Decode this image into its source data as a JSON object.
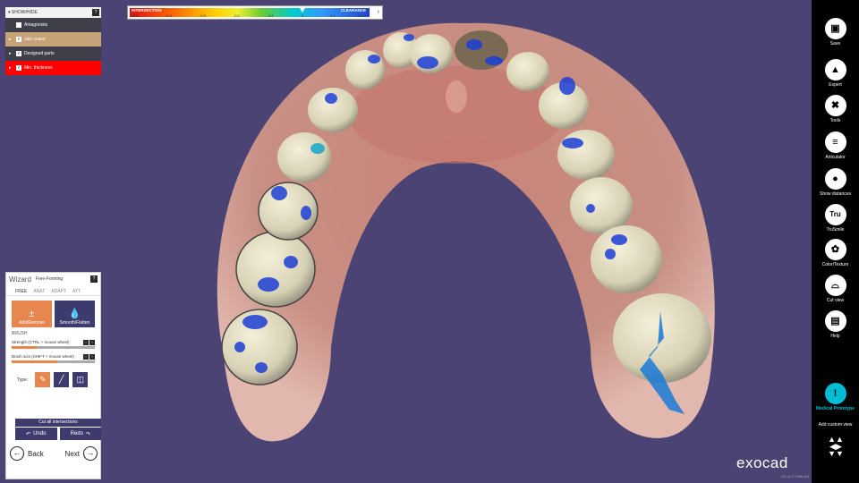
{
  "show_hide": {
    "header": "SHOW/HIDE",
    "help": "?",
    "items": [
      {
        "label": "Antagonists",
        "checked": false
      },
      {
        "label": "Jaw scans",
        "checked": true
      },
      {
        "label": "Designed parts",
        "checked": true
      },
      {
        "label": "Min. thickness",
        "checked": true
      }
    ]
  },
  "color_scale": {
    "left_label": "INTERSECTION",
    "right_label": "CLEARANCE",
    "ticks": [
      "-0.5",
      "-0.4",
      "-0.3",
      "-0.2",
      "-0.1",
      "0",
      "0.1",
      "0.2"
    ],
    "left_value": "-0.5",
    "right_value": "0.2"
  },
  "wizard": {
    "title": "Wizard",
    "subtitle": "Free-Forming",
    "help": "?",
    "tabs": [
      "FREE",
      "ANAT",
      "ADAPT",
      "ATT"
    ],
    "tool_add": "Add/Remove",
    "tool_smooth": "Smooth/Flatten",
    "section": "BRUSH",
    "strength_label": "Strength (CTRL + mouse wheel)",
    "strength_value": 0.3,
    "size_label": "Brush size (SHIFT + mouse wheel)",
    "size_value": 0.55,
    "type_label": "Type:",
    "cut_all": "Cut all intersections",
    "undo": "Undo",
    "redo": "Redo",
    "back": "Back",
    "next": "Next"
  },
  "toolbar": [
    {
      "label": "Save",
      "icon": "save-icon"
    },
    {
      "label": "Expert",
      "icon": "graduation-cap-icon"
    },
    {
      "label": "Tools",
      "icon": "tools-icon"
    },
    {
      "label": "Articulator",
      "icon": "articulator-icon"
    },
    {
      "label": "Show distances",
      "icon": "distance-icon"
    },
    {
      "label": "TruSmile",
      "icon": "trusmile-icon"
    },
    {
      "label": "Color/Texture",
      "icon": "palette-icon"
    },
    {
      "label": "Cut view",
      "icon": "cut-view-icon"
    },
    {
      "label": "Help",
      "icon": "help-book-icon"
    }
  ],
  "trusmile_glyph": "Tru",
  "medical": {
    "label": "Medical Prototype",
    "icon": "warning-icon"
  },
  "add_view": "Add custom view",
  "brand": "exocad",
  "version": "CS-v2.3 7080 (64"
}
